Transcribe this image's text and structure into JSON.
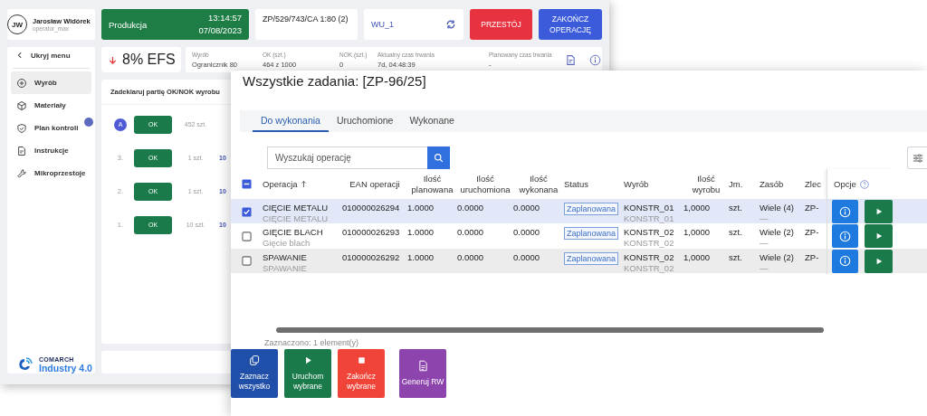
{
  "app": {
    "user": {
      "initials": "JW",
      "name": "Jarosław Widórek",
      "login": "operator_max"
    },
    "mode": {
      "label": "Produkcja",
      "time": "13:14:57",
      "date": "07/08/2023"
    },
    "order": "ZP/529/743/CA 1:80 (2)",
    "workcenter": "WU_1",
    "buttons": [
      {
        "label": "PRZESTÓJ",
        "kind": "danger"
      },
      {
        "label": "ZAKOŃCZ OPERACJĘ",
        "kind": "primary"
      }
    ],
    "efficiency": {
      "value": "8% EFS",
      "falling": true
    },
    "info": [
      {
        "label": "Wyrób",
        "value": "Ogranicznik 80"
      },
      {
        "label": "OK (szt.)",
        "value": "464 z 1000"
      },
      {
        "label": "NOK (szt.)",
        "value": "0"
      },
      {
        "label": "Aktualny czas trwania",
        "value": "7d, 04:48:39"
      },
      {
        "label": "Planowany czas trwania",
        "value": "-"
      }
    ],
    "sidebar": {
      "toggle": "Ukryj menu",
      "items": [
        {
          "label": "Wyrób",
          "selected": true,
          "badge": false
        },
        {
          "label": "Materiały",
          "selected": false,
          "badge": false
        },
        {
          "label": "Plan kontroli",
          "selected": false,
          "badge": true
        },
        {
          "label": "Instrukcje",
          "selected": false,
          "badge": false
        },
        {
          "label": "Mikroprzestoje",
          "selected": false,
          "badge": false
        }
      ]
    },
    "brand": {
      "company": "COMARCH",
      "product": "Industry 4.0"
    },
    "declare": {
      "title": "Zadeklaruj partię OK/NOK wyrobu",
      "rows": [
        {
          "kind": "badge",
          "marker": "A",
          "button": "OK",
          "quantity": "452 szt."
        },
        {
          "kind": "number",
          "marker": "3.",
          "button": "OK",
          "quantity": "1 szt.",
          "column_4": "10"
        },
        {
          "kind": "number",
          "marker": "2.",
          "button": "OK",
          "quantity": "1 szt.",
          "column_4": "10"
        },
        {
          "kind": "number",
          "marker": "1.",
          "button": "OK",
          "quantity": "10 szt.",
          "column_4": "10"
        }
      ]
    }
  },
  "dialog": {
    "title": "Wszystkie zadania: [ZP-96/25]",
    "tabs": [
      {
        "label": "Do wykonania",
        "selected": true
      },
      {
        "label": "Uruchomione",
        "selected": false
      },
      {
        "label": "Wykonane",
        "selected": false
      }
    ],
    "search": {
      "placeholder": "Wyszukaj operację"
    },
    "table": {
      "select_all_partial": true,
      "columns": [
        {
          "label": "Operacja",
          "sorted": true
        },
        {
          "label": "EAN operacji",
          "sorted": false
        },
        {
          "label": "Ilość planowana",
          "sorted": false
        },
        {
          "label": "Ilość uruchomiona",
          "sorted": false
        },
        {
          "label": "Ilość wykonana",
          "sorted": false
        },
        {
          "label": "Status",
          "sorted": false
        },
        {
          "label": "Wyrób",
          "sorted": false
        },
        {
          "label": "Ilość wyrobu",
          "sorted": false
        },
        {
          "label": "Jm.",
          "sorted": false
        },
        {
          "label": "Zasób",
          "sorted": false
        },
        {
          "label": "Zlec",
          "sorted": false
        },
        {
          "label": "Opcje",
          "sorted": false,
          "help": true
        }
      ],
      "rows": [
        {
          "checked": true,
          "selected": true,
          "operation": "CIĘCIE METALU",
          "operation_sub": "CIĘCIE METALU",
          "ean": "010000026294",
          "planned": "1.0000",
          "started": "0.0000",
          "done": "0.0000",
          "status": "Zaplanowana",
          "product": "KONSTR_01",
          "product_sub": "KONSTR_01",
          "product_qty": "1,0000",
          "unit": "szt.",
          "resource": "Wiele (4)",
          "resource_sub": "—",
          "order": "ZP-"
        },
        {
          "checked": false,
          "selected": false,
          "operation": "GIĘCIE BLACH",
          "operation_sub": "Gięcie blach",
          "ean": "010000026293",
          "planned": "1.0000",
          "started": "0.0000",
          "done": "0.0000",
          "status": "Zaplanowana",
          "product": "KONSTR_02",
          "product_sub": "KONSTR_02",
          "product_qty": "1,0000",
          "unit": "szt.",
          "resource": "Wiele (2)",
          "resource_sub": "—",
          "order": "ZP-"
        },
        {
          "checked": false,
          "selected": false,
          "operation": "SPAWANIE",
          "operation_sub": "SPAWANIE",
          "ean": "010000026292",
          "planned": "1.0000",
          "started": "0.0000",
          "done": "0.0000",
          "status": "Zaplanowana",
          "product": "KONSTR_02",
          "product_sub": "KONSTR_02",
          "product_qty": "1,0000",
          "unit": "szt.",
          "resource": "Wiele (2)",
          "resource_sub": "—",
          "order": "ZP-"
        }
      ]
    },
    "selection_note": "Zaznaczono: 1 element(y)",
    "actions": [
      {
        "label": "Zaznacz wszystko",
        "kind": "select"
      },
      {
        "label": "Uruchom wybrane",
        "kind": "start"
      },
      {
        "label": "Zakończ wybrane",
        "kind": "stop"
      },
      {
        "label": "Generuj RW",
        "kind": "document"
      }
    ]
  }
}
